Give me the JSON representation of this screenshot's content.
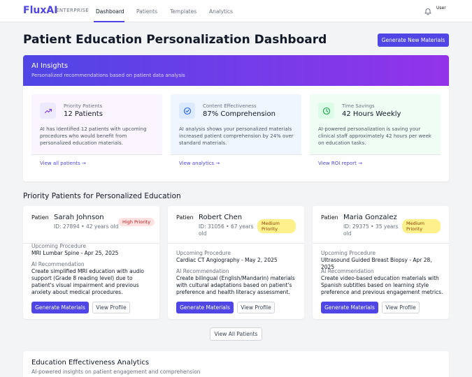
{
  "nav": {
    "logo": "FluxAI",
    "edition": "ENTERPRISE",
    "links": [
      "Dashboard",
      "Patients",
      "Templates",
      "Analytics"
    ],
    "avatar_alt": "User"
  },
  "header": {
    "title": "Patient Education Personalization Dashboard",
    "generate_button": "Generate New Materials"
  },
  "insights": {
    "title": "AI Insights",
    "subtitle": "Personalized recommendations based on patient data analysis",
    "cards": [
      {
        "label": "Priority Patients",
        "value": "12 Patients",
        "description": "AI has identified 12 patients with upcoming procedures who would benefit from personalized education materials.",
        "link": "View all patients →",
        "icon": "trending-up-icon",
        "bg": "#faf5ff",
        "icon_bg": "#ede9fe",
        "icon_color": "#7c3aed"
      },
      {
        "label": "Content Effectiveness",
        "value": "87% Comprehension",
        "description": "AI analysis shows your personalized materials increased patient comprehension by 24% over standard materials.",
        "link": "View analytics →",
        "icon": "check-circle-icon",
        "bg": "#eff6ff",
        "icon_bg": "#dbeafe",
        "icon_color": "#2563eb"
      },
      {
        "label": "Time Savings",
        "value": "42 Hours Weekly",
        "description": "AI-powered personalization is saving your clinical staff approximately 42 hours per week on education tasks.",
        "link": "View ROI report →",
        "icon": "clock-icon",
        "bg": "#f0fdf4",
        "icon_bg": "#dcfce7",
        "icon_color": "#16a34a"
      }
    ]
  },
  "priority": {
    "title": "Priority Patients for Personalized Education",
    "upcoming_label": "Upcoming Procedure",
    "recommendation_label": "AI Recommendation",
    "generate_label": "Generate Materials",
    "view_label": "View Profile",
    "image_alt": "Patient",
    "patients": [
      {
        "name": "Sarah Johnson",
        "meta": "ID: 27894 • 42 years old",
        "priority": "High Priority",
        "procedure": "MRI Lumbar Spine - Apr 25, 2025",
        "recommendation": "Create simplified MRI education with audio support (Grade 8 reading level) due to patient's visual impairment and previous anxiety about medical procedures."
      },
      {
        "name": "Robert Chen",
        "meta": "ID: 31056 • 67 years old",
        "priority": "Medium Priority",
        "procedure": "Cardiac CT Angiography - May 2, 2025",
        "recommendation": "Create bilingual (English/Mandarin) materials with cultural adaptations based on patient's preference and health literacy assessment."
      },
      {
        "name": "Maria Gonzalez",
        "meta": "ID: 29375 • 35 years old",
        "priority": "Medium Priority",
        "procedure": "Ultrasound Guided Breast Biopsy - Apr 28, 2025",
        "recommendation": "Create video-based education materials with Spanish subtitles based on learning style preference and previous engagement metrics."
      }
    ],
    "view_all": "View All Patients"
  },
  "analytics": {
    "title": "Education Effectiveness Analytics",
    "subtitle": "AI-powered insights on patient engagement and comprehension"
  },
  "colors": {
    "accent": "#4f46e5",
    "gradient_end": "#9333ea"
  }
}
